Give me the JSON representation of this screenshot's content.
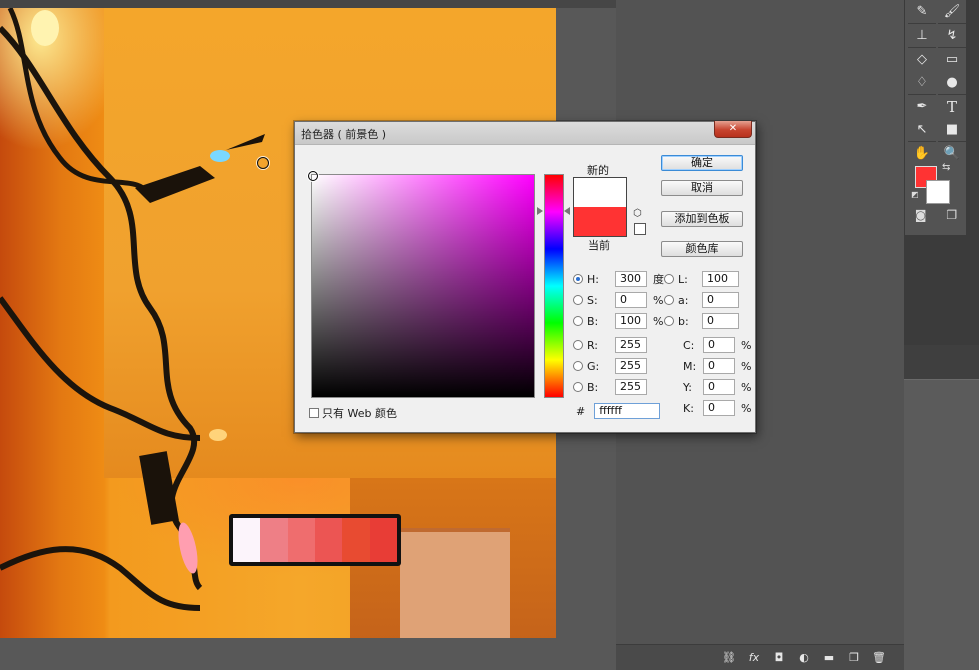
{
  "dialog": {
    "title": "拾色器 ( 前景色 )",
    "close_glyph": "✕",
    "new_label": "新的",
    "current_label": "当前",
    "buttons": {
      "ok": "确定",
      "cancel": "取消",
      "add_swatches": "添加到色板",
      "color_libraries": "颜色库"
    },
    "only_web_colors": "只有 Web 颜色",
    "fields": {
      "H": {
        "label": "H:",
        "value": "300",
        "unit": "度"
      },
      "S": {
        "label": "S:",
        "value": "0",
        "unit": "%"
      },
      "Bv": {
        "label": "B:",
        "value": "100",
        "unit": "%"
      },
      "R": {
        "label": "R:",
        "value": "255"
      },
      "G": {
        "label": "G:",
        "value": "255"
      },
      "Bc": {
        "label": "B:",
        "value": "255"
      },
      "L": {
        "label": "L:",
        "value": "100"
      },
      "a": {
        "label": "a:",
        "value": "0"
      },
      "b": {
        "label": "b:",
        "value": "0"
      },
      "C": {
        "label": "C:",
        "value": "0",
        "unit": "%"
      },
      "M": {
        "label": "M:",
        "value": "0",
        "unit": "%"
      },
      "Y": {
        "label": "Y:",
        "value": "0",
        "unit": "%"
      },
      "K": {
        "label": "K:",
        "value": "0",
        "unit": "%"
      }
    },
    "hex_label": "#",
    "hex_value": "ffffff",
    "new_color": "#ffffff",
    "current_color": "#ff3333"
  },
  "colors": {
    "foreground": "#ff3333",
    "background": "#ffffff",
    "swatches": [
      "#fcf4fb",
      "#ee7f86",
      "#ef6d6e",
      "#ec5553",
      "#e84b31",
      "#e83d36"
    ]
  },
  "icons": {
    "tools": [
      "brush-icon",
      "stamp-icon",
      "eraser-icon",
      "gradient-icon",
      "pen-icon",
      "type-icon",
      "path-select-icon",
      "shape-icon",
      "hand-icon",
      "zoom-icon"
    ],
    "bottom": [
      "link-icon",
      "fx-icon",
      "mask-icon",
      "adjustment-icon",
      "folder-icon",
      "new-layer-icon",
      "trash-icon"
    ]
  },
  "tools": {
    "type_glyph": "T",
    "bottom_glyphs": [
      "⛓",
      "fx",
      "◘",
      "◐",
      "▬",
      "❐",
      "🗑"
    ]
  }
}
